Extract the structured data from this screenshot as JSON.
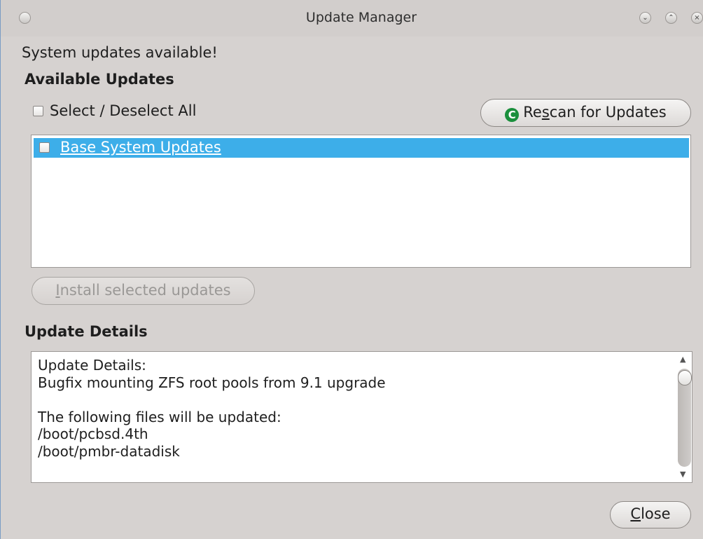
{
  "window": {
    "title": "Update Manager",
    "menu_icon": "window-menu-icon",
    "minimize_icon": "minimize-icon",
    "maximize_icon": "maximize-icon",
    "close_icon": "close-icon"
  },
  "status_text": "System updates available!",
  "available": {
    "heading": "Available Updates",
    "select_all_label": "Select / Deselect All",
    "select_all_checked": false,
    "rescan_icon": "refresh-icon",
    "rescan_label_pre": "Re",
    "rescan_label_mnemonic": "s",
    "rescan_label_post": "can for Updates",
    "items": [
      {
        "label": "Base System Updates",
        "checked": false,
        "selected": true
      }
    ],
    "install_mnemonic": "I",
    "install_label_post": "nstall selected updates",
    "install_enabled": false
  },
  "details": {
    "heading": "Update Details",
    "lines": [
      "Update Details:",
      "Bugfix mounting ZFS root pools from 9.1 upgrade",
      "",
      "The following files will be updated:",
      "/boot/pcbsd.4th",
      "/boot/pmbr-datadisk"
    ]
  },
  "footer": {
    "close_mnemonic": "C",
    "close_label_post": "lose"
  },
  "colors": {
    "selection": "#3daee9",
    "background": "#d6d2d0",
    "rescan_icon": "#1a8f3c"
  }
}
